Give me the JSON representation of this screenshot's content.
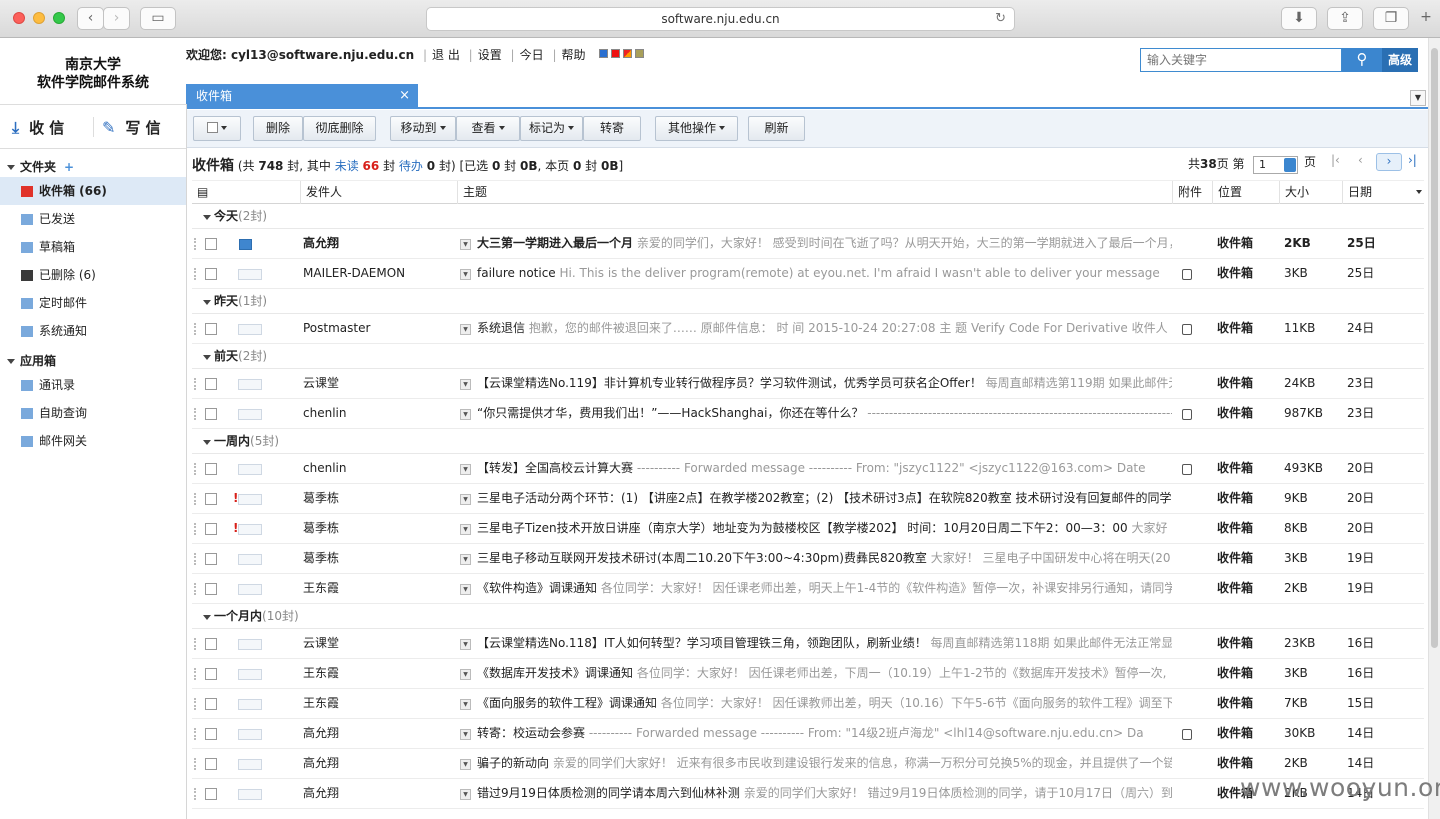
{
  "browser": {
    "url": "software.nju.edu.cn"
  },
  "app": {
    "logo_line1": "南京大学",
    "logo_line2": "软件学院邮件系统"
  },
  "topnav": {
    "welcome": "欢迎您: cyl13@software.nju.edu.cn",
    "logout": "退 出",
    "settings": "设置",
    "today": "今日",
    "help": "帮助"
  },
  "search": {
    "placeholder": "输入关键字",
    "advanced": "高级"
  },
  "tab": {
    "label": "收件箱",
    "close": "×"
  },
  "sidebar": {
    "receive": "收 信",
    "write": "写 信",
    "folders_title": "文件夹",
    "folders": [
      {
        "label": "收件箱 (66)"
      },
      {
        "label": "已发送"
      },
      {
        "label": "草稿箱"
      },
      {
        "label": "已删除 (6)"
      },
      {
        "label": "定时邮件"
      },
      {
        "label": "系统通知"
      }
    ],
    "apps_title": "应用箱",
    "apps": [
      {
        "label": "通讯录"
      },
      {
        "label": "自助查询"
      },
      {
        "label": "邮件网关"
      }
    ]
  },
  "toolbar": {
    "delete": "删除",
    "delete_perm": "彻底删除",
    "move_to": "移动到",
    "view": "查看",
    "mark_as": "标记为",
    "forward": "转寄",
    "other": "其他操作",
    "refresh": "刷新"
  },
  "summary": {
    "title": "收件箱",
    "p1": "(共",
    "total": "748",
    "p2": "封, 其中",
    "unread_label": "未读",
    "unread": "66",
    "p3": "封",
    "todo_label": "待办",
    "todo": "0",
    "p4": "封)",
    "p5": "[已选",
    "sel_count": "0",
    "p6": "封",
    "sel_size": "0B",
    "p7": ", 本页",
    "page_count": "0",
    "p8": "封",
    "page_size": "0B",
    "p9": "]"
  },
  "pager": {
    "p1": "共",
    "total_pages": "38",
    "p2": "页 第",
    "current": "1",
    "p3": "页"
  },
  "columns": {
    "sender": "发件人",
    "subject": "主题",
    "attach": "附件",
    "location": "位置",
    "size": "大小",
    "date": "日期"
  },
  "groups": [
    {
      "label": "今天",
      "count": "(2封)",
      "mails": [
        {
          "sender": "高允翔",
          "subject": "大三第一学期进入最后一个月",
          "preview": " 亲爱的同学们，大家好！ 感受到时间在飞逝了吗？从明天开始，大三的第一学期就进入了最后一个月，",
          "location": "收件箱",
          "size": "2KB",
          "date": "25日"
        },
        {
          "sender": "MAILER-DAEMON",
          "subject": "failure notice",
          "preview": " Hi. This is the deliver program(remote) at eyou.net. I'm afraid I wasn't able to deliver your message",
          "location": "收件箱",
          "size": "3KB",
          "date": "25日"
        }
      ]
    },
    {
      "label": "昨天",
      "count": "(1封)",
      "mails": [
        {
          "sender": "Postmaster",
          "subject": "系统退信",
          "preview": " 抱歉，您的邮件被退回来了…… 原邮件信息： 时 间 2015-10-24 20:27:08 主 题 Verify Code For Derivative 收件人",
          "location": "收件箱",
          "size": "11KB",
          "date": "24日"
        }
      ]
    },
    {
      "label": "前天",
      "count": "(2封)",
      "mails": [
        {
          "sender": "云课堂",
          "subject": "【云课堂精选No.119】非计算机专业转行做程序员？学习软件测试，优秀学员可获名企Offer！",
          "preview": " 每周直邮精选第119期 如果此邮件无法正常显示",
          "location": "收件箱",
          "size": "24KB",
          "date": "23日"
        },
        {
          "sender": "chenlin",
          "subject": "“你只需提供才华，费用我们出！”——HackShanghai，你还在等什么？",
          "preview": " --------------------------------------------------------------------------",
          "location": "收件箱",
          "size": "987KB",
          "date": "23日"
        }
      ]
    },
    {
      "label": "一周内",
      "count": "(5封)",
      "mails": [
        {
          "sender": "chenlin",
          "subject": "【转发】全国高校云计算大赛",
          "preview": " ---------- Forwarded message ---------- From: \"jszyc1122\" <jszyc1122@163.com> Date",
          "location": "收件箱",
          "size": "493KB",
          "date": "20日"
        },
        {
          "sender": "葛季栋",
          "subject": "三星电子活动分两个环节：(1) 【讲座2点】在教学楼202教室；(2) 【技术研讨3点】在软院820教室 技术研讨没有回复邮件的同学",
          "preview": "",
          "location": "收件箱",
          "size": "9KB",
          "date": "20日"
        },
        {
          "sender": "葛季栋",
          "subject": "三星电子Tizen技术开放日讲座（南京大学）地址变为为鼓楼校区【教学楼202】 时间：10月20日周二下午2：00—3：00",
          "preview": " 大家好",
          "location": "收件箱",
          "size": "8KB",
          "date": "20日"
        },
        {
          "sender": "葛季栋",
          "subject": "三星电子移动互联网开发技术研讨(本周二10.20下午3:00~4:30pm)费彝民820教室",
          "preview": " 大家好！ 三星电子中国研发中心将在明天(20",
          "location": "收件箱",
          "size": "3KB",
          "date": "19日"
        },
        {
          "sender": "王东霞",
          "subject": "《软件构造》调课通知",
          "preview": " 各位同学：大家好！ 因任课老师出差，明天上午1-4节的《软件构造》暂停一次，补课安排另行通知，请同学",
          "location": "收件箱",
          "size": "2KB",
          "date": "19日"
        }
      ]
    },
    {
      "label": "一个月内",
      "count": "(10封)",
      "mails": [
        {
          "sender": "云课堂",
          "subject": "【云课堂精选No.118】IT人如何转型？学习项目管理铁三角，领跑团队，刷新业绩！",
          "preview": " 每周直邮精选第118期 如果此邮件无法正常显示",
          "location": "收件箱",
          "size": "23KB",
          "date": "16日"
        },
        {
          "sender": "王东霞",
          "subject": "《数据库开发技术》调课通知",
          "preview": " 各位同学：大家好！ 因任课老师出差，下周一（10.19）上午1-2节的《数据库开发技术》暂停一次,",
          "location": "收件箱",
          "size": "3KB",
          "date": "16日"
        },
        {
          "sender": "王东霞",
          "subject": "《面向服务的软件工程》调课通知",
          "preview": " 各位同学：大家好！ 因任课教师出差，明天（10.16）下午5-6节《面向服务的软件工程》调至下",
          "location": "收件箱",
          "size": "7KB",
          "date": "15日"
        },
        {
          "sender": "高允翔",
          "subject": "转寄：校运动会参赛",
          "preview": " ---------- Forwarded message ---------- From: \"14级2班卢海龙\" <lhl14@software.nju.edu.cn> Da",
          "location": "收件箱",
          "size": "30KB",
          "date": "14日"
        },
        {
          "sender": "高允翔",
          "subject": "骗子的新动向",
          "preview": " 亲爱的同学们大家好！ 近来有很多市民收到建设银行发来的信息，称满一万积分可兑换5%的现金，并且提供了一个链",
          "location": "收件箱",
          "size": "2KB",
          "date": "14日"
        },
        {
          "sender": "高允翔",
          "subject": "错过9月19日体质检测的同学请本周六到仙林补测",
          "preview": " 亲爱的同学们大家好！ 错过9月19日体质检测的同学，请于10月17日（周六）到",
          "location": "收件箱",
          "size": "2KB",
          "date": "14日"
        }
      ]
    }
  ],
  "watermark": "www.wooyun.org"
}
